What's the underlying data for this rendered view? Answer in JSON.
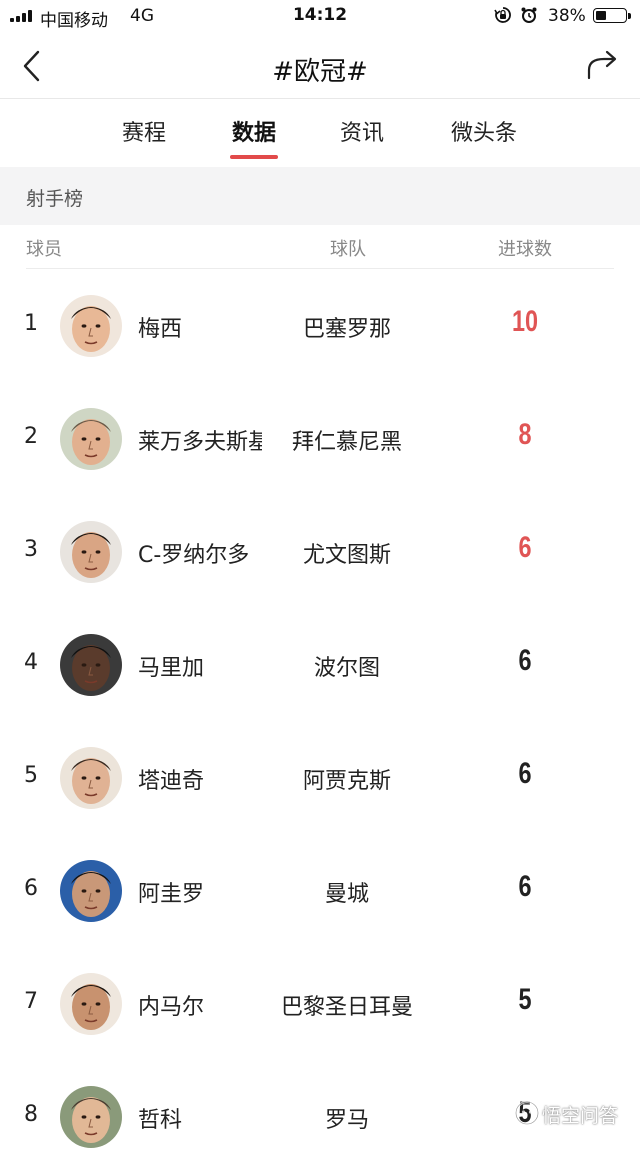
{
  "status_bar": {
    "carrier": "中国移动",
    "network": "4G",
    "time": "14:12",
    "battery_percent_text": "38%",
    "battery_level": 0.38
  },
  "nav": {
    "title": "#欧冠#"
  },
  "tabs": [
    {
      "label": "赛程",
      "active": false
    },
    {
      "label": "数据",
      "active": true
    },
    {
      "label": "资讯",
      "active": false
    },
    {
      "label": "微头条",
      "active": false
    }
  ],
  "section": {
    "title": "射手榜",
    "columns": {
      "player": "球员",
      "team": "球队",
      "goals": "进球数"
    }
  },
  "scorers": [
    {
      "rank": "1",
      "name": "梅西",
      "team": "巴塞罗那",
      "goals": "10"
    },
    {
      "rank": "2",
      "name": "莱万多夫斯基",
      "team": "拜仁慕尼黑",
      "goals": "8"
    },
    {
      "rank": "3",
      "name": "C-罗纳尔多",
      "team": "尤文图斯",
      "goals": "6"
    },
    {
      "rank": "4",
      "name": "马里加",
      "team": "波尔图",
      "goals": "6"
    },
    {
      "rank": "5",
      "name": "塔迪奇",
      "team": "阿贾克斯",
      "goals": "6"
    },
    {
      "rank": "6",
      "name": "阿圭罗",
      "team": "曼城",
      "goals": "6"
    },
    {
      "rank": "7",
      "name": "内马尔",
      "team": "巴黎圣日耳曼",
      "goals": "5"
    },
    {
      "rank": "8",
      "name": "哲科",
      "team": "罗马",
      "goals": "5"
    }
  ],
  "colors": {
    "accent": "#e24a4a",
    "top3_goals": "#e05555"
  },
  "icons": {
    "back": "chevron-left-icon",
    "share": "share-arrow-icon",
    "rotation_lock": "rotation-lock-icon",
    "alarm": "alarm-icon"
  },
  "watermark": {
    "text": "悟空问答"
  }
}
